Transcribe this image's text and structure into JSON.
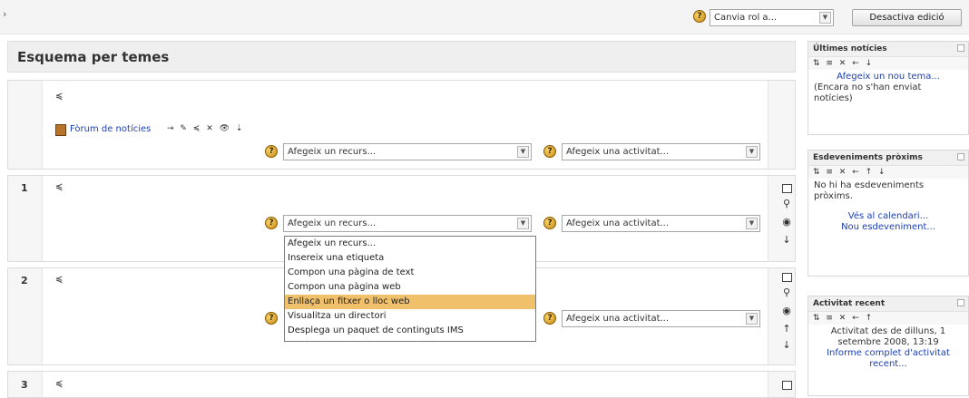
{
  "topbar": {
    "left_marker": "›",
    "role_select": "Canvia rol a...",
    "edit_button": "Desactiva edició",
    "help_glyph": "?"
  },
  "main": {
    "title": "Esquema per temes",
    "edit_glyph": "≼",
    "forum": {
      "label": "Fòrum de notícies",
      "actions": "→ ✎ ≼ ✕ 👁 ⇣"
    },
    "add_resource": "Afegeix un recurs...",
    "add_activity": "Afegeix una activitat...",
    "sections": [
      {
        "number": "1"
      },
      {
        "number": "2"
      },
      {
        "number": "3"
      }
    ],
    "dropdown_options": [
      "Afegeix un recurs...",
      "Insereix una etiqueta",
      "Compon una pàgina de text",
      "Compon una pàgina web",
      "Enllaça un fitxer o lloc web",
      "Visualitza un directori",
      "Desplega un paquet de continguts IMS"
    ],
    "dropdown_selected_index": 4,
    "side_glyphs": {
      "square": "□",
      "bulb": "💡",
      "eye": "👁",
      "down": "↓",
      "up": "↑"
    }
  },
  "sidebar": {
    "news": {
      "title": "Últimes notícies",
      "icons": "⇅ ≡ ✕ ← ↓",
      "link": "Afegeix un nou tema...",
      "text": "(Encara no s'han enviat notícies)"
    },
    "events": {
      "title": "Esdeveniments pròxims",
      "icons": "⇅ ≡ ✕ ← ↑ ↓",
      "text": "No hi ha esdeveniments pròxims.",
      "link1": "Vés al calendari...",
      "link2": "Nou esdeveniment..."
    },
    "recent": {
      "title": "Activitat recent",
      "icons": "⇅ ≡ ✕ ← ↑",
      "text": "Activitat des de dilluns, 1 setembre 2008, 13:19",
      "link": "Informe complet d'activitat recent..."
    }
  }
}
